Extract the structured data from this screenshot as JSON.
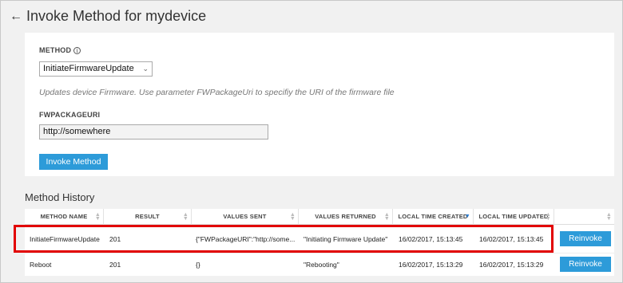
{
  "header": {
    "back_icon": "arrow-left-icon",
    "title": "Invoke Method for mydevice"
  },
  "form": {
    "method_label": "METHOD",
    "method_info_icon": "info-icon",
    "method_value": "InitiateFirmwareUpdate",
    "description": "Updates device Firmware. Use parameter FWPackageUri to specifiy the URI of the firmware file",
    "param_label": "FWPACKAGEURI",
    "param_value": "http://somewhere",
    "invoke_label": "Invoke Method"
  },
  "history": {
    "title": "Method History",
    "columns": [
      "METHOD NAME",
      "RESULT",
      "VALUES SENT",
      "VALUES RETURNED",
      "LOCAL TIME CREATED",
      "LOCAL TIME UPDATED"
    ],
    "sorted_column": "LOCAL TIME CREATED",
    "rows": [
      {
        "method": "InitiateFirmwareUpdate",
        "result": "201",
        "sent": "{\"FWPackageURI\":\"http://some...",
        "returned": "\"Initiating Firmware Update\"",
        "created": "16/02/2017, 15:13:45",
        "updated": "16/02/2017, 15:13:45",
        "action": "Reinvoke"
      },
      {
        "method": "Reboot",
        "result": "201",
        "sent": "{}",
        "returned": "\"Rebooting\"",
        "created": "16/02/2017, 15:13:29",
        "updated": "16/02/2017, 15:13:29",
        "action": "Reinvoke"
      }
    ]
  },
  "colors": {
    "accent": "#2d9bd9",
    "highlight": "#e20000"
  }
}
